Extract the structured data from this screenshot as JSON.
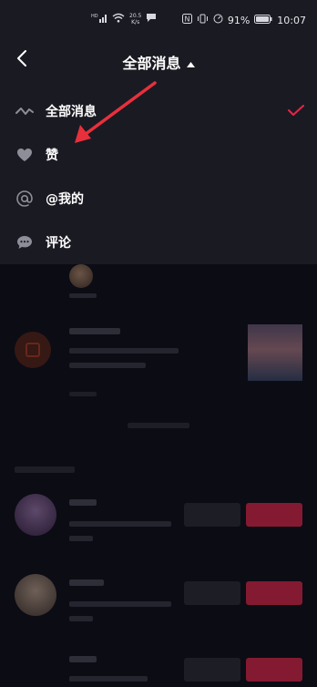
{
  "status_bar": {
    "speed_value": "20.5",
    "speed_unit": "K/s",
    "battery": "91%",
    "time": "10:07"
  },
  "header": {
    "title": "全部消息"
  },
  "dropdown": {
    "items": [
      {
        "label": "全部消息",
        "icon": "wave-icon",
        "selected": true
      },
      {
        "label": "赞",
        "icon": "heart-icon",
        "selected": false
      },
      {
        "label": "@我的",
        "icon": "at-icon",
        "selected": false
      },
      {
        "label": "评论",
        "icon": "comment-icon",
        "selected": false
      }
    ]
  },
  "colors": {
    "accent": "#e6264a",
    "background": "#0c0c14",
    "panel": "#1a1a22",
    "annotation_arrow": "#e8303c"
  }
}
